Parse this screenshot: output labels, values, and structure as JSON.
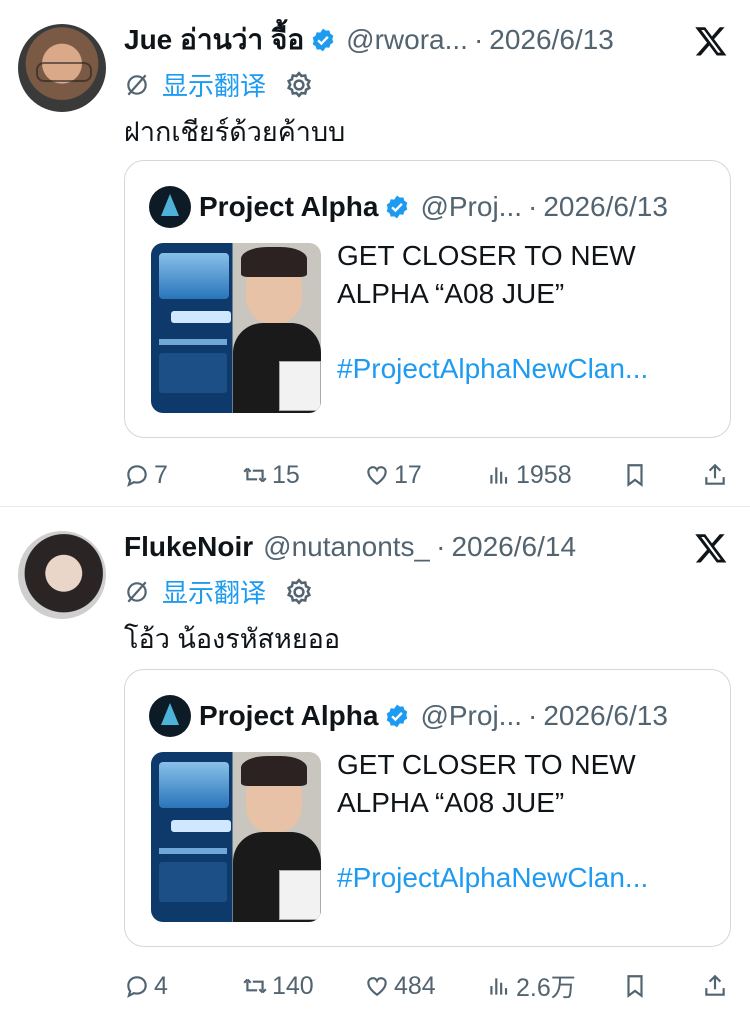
{
  "tweets": [
    {
      "name": "Jue อ่านว่า จื้อ",
      "handle": "@rwora...",
      "date": "2026/6/13",
      "translate_label": "显示翻译",
      "text": "ฝากเชียร์ด้วยค้าบบ",
      "quote": {
        "name": "Project Alpha",
        "handle": "@Proj...",
        "date": "2026/6/13",
        "text": "GET CLOSER TO NEW ALPHA “A08 JUE”",
        "hashtag": "#ProjectAlphaNewClan..."
      },
      "stats": {
        "replies": "7",
        "retweets": "15",
        "likes": "17",
        "views": "1958"
      }
    },
    {
      "name": "FlukeNoir",
      "handle": "@nutanonts_",
      "date": "2026/6/14",
      "translate_label": "显示翻译",
      "text": "โอ้ว น้องรหัสหยออ",
      "quote": {
        "name": "Project Alpha",
        "handle": "@Proj...",
        "date": "2026/6/13",
        "text": "GET CLOSER TO NEW ALPHA “A08 JUE”",
        "hashtag": "#ProjectAlphaNewClan..."
      },
      "stats": {
        "replies": "4",
        "retweets": "140",
        "likes": "484",
        "views": "2.6万"
      }
    }
  ],
  "colors": {
    "accent": "#1d9bf0",
    "muted": "#536471",
    "border": "#cfd9de"
  },
  "icons": [
    "verified-badge-icon",
    "x-logo-icon",
    "translate-icon",
    "gear-icon",
    "reply-icon",
    "retweet-icon",
    "like-icon",
    "views-icon",
    "bookmark-icon",
    "share-icon"
  ]
}
